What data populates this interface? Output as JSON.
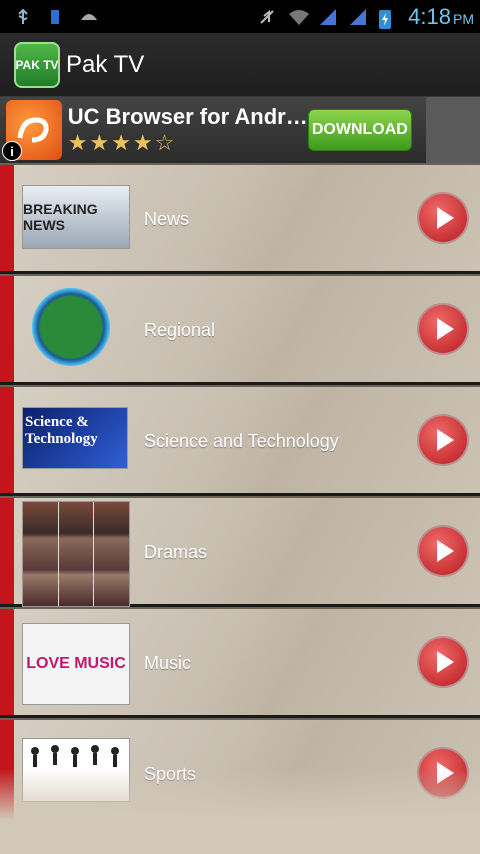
{
  "status": {
    "time": "4:18",
    "ampm": "PM"
  },
  "appbar": {
    "title": "Pak TV",
    "icon_text": "PAK TV"
  },
  "ad": {
    "title": "UC Browser for Andr…",
    "rating_stars": "★★★★☆",
    "button": "DOWNLOAD",
    "info": "i"
  },
  "categories": [
    {
      "label": "News",
      "thumb": "BREAKING NEWS"
    },
    {
      "label": "Regional",
      "thumb": ""
    },
    {
      "label": "Science and Technology",
      "thumb": "Science & Technology"
    },
    {
      "label": "Dramas",
      "thumb": ""
    },
    {
      "label": "Music",
      "thumb": "LOVE MUSIC"
    },
    {
      "label": "Sports",
      "thumb": ""
    }
  ]
}
